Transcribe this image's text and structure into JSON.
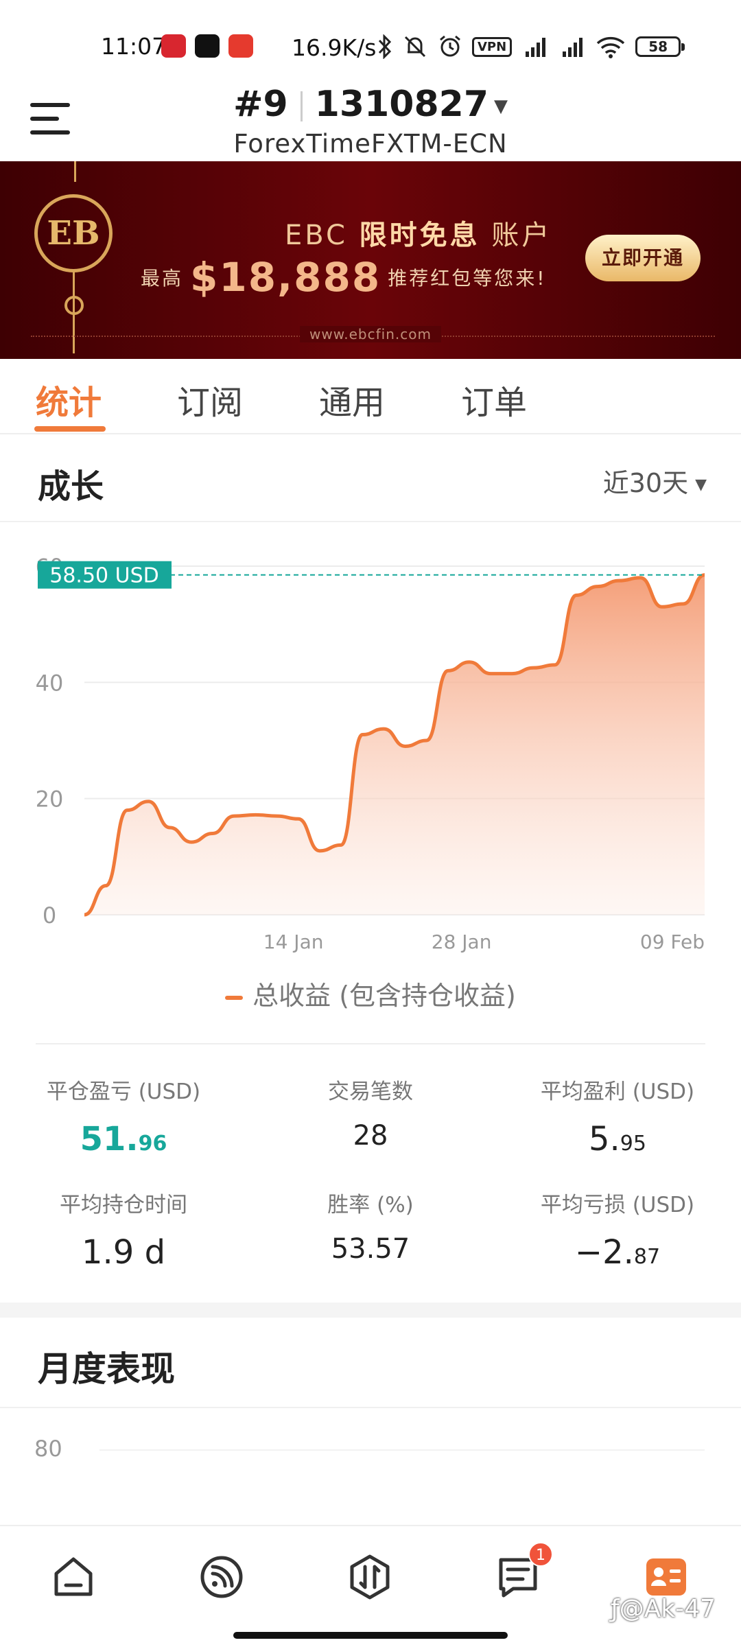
{
  "status_bar": {
    "time": "11:07",
    "net_speed": "16.9K/s",
    "vpn": "VPN",
    "battery": "58"
  },
  "header": {
    "account_index": "#9",
    "account_number": "1310827",
    "server": "ForexTimeFXTM-ECN"
  },
  "banner": {
    "logo": "EB",
    "line1_pre": "EBC ",
    "line1_bold": "限时免息",
    "line1_post": " 账户",
    "line2_pre": "最高",
    "line2_amount": "$18,888",
    "line2_post": "推荐红包等您来!",
    "cta": "立即开通",
    "site": "www.ebcfin.com"
  },
  "tabs": [
    "统计",
    "订阅",
    "通用",
    "订单"
  ],
  "growth": {
    "title": "成长",
    "range": "近30天"
  },
  "chart_data": {
    "type": "area",
    "y_ticks": [
      "0",
      "20",
      "40",
      "60"
    ],
    "x_ticks": [
      "14 Jan",
      "28 Jan",
      "09 Feb"
    ],
    "ylim": [
      0,
      60
    ],
    "current_value_label": "58.50 USD",
    "current_value": 58.5,
    "series": [
      {
        "name": "总收益 (包含持仓收益)",
        "color": "#f07a3a",
        "values": [
          0,
          5,
          18,
          19.5,
          15,
          12.5,
          14,
          17,
          17.2,
          17,
          16.5,
          11,
          12,
          31,
          32,
          29,
          30,
          42,
          43.5,
          41.5,
          41.5,
          42.5,
          43,
          55,
          56.5,
          57.5,
          58,
          53,
          53.5,
          58.5
        ]
      }
    ]
  },
  "legend": "总收益 (包含持仓收益)",
  "stats": [
    {
      "label": "平仓盈亏 (USD)",
      "int": "51.",
      "dec": "96"
    },
    {
      "label": "交易笔数",
      "value": "28"
    },
    {
      "label": "平均盈利 (USD)",
      "int": "5.",
      "dec": "95"
    },
    {
      "label": "平均持仓时间",
      "value": "1.9 d"
    },
    {
      "label": "胜率 (%)",
      "value": "53.57"
    },
    {
      "label": "平均亏损 (USD)",
      "int": "−2.",
      "dec": "87"
    }
  ],
  "monthly": {
    "title": "月度表现",
    "y_tick": "80"
  },
  "bottom_nav": {
    "badge": "1",
    "watermark": "ƒ@Ak-47"
  },
  "colors": {
    "accent": "#f07a3a",
    "teal": "#17a79a",
    "badge": "#f0533a"
  }
}
